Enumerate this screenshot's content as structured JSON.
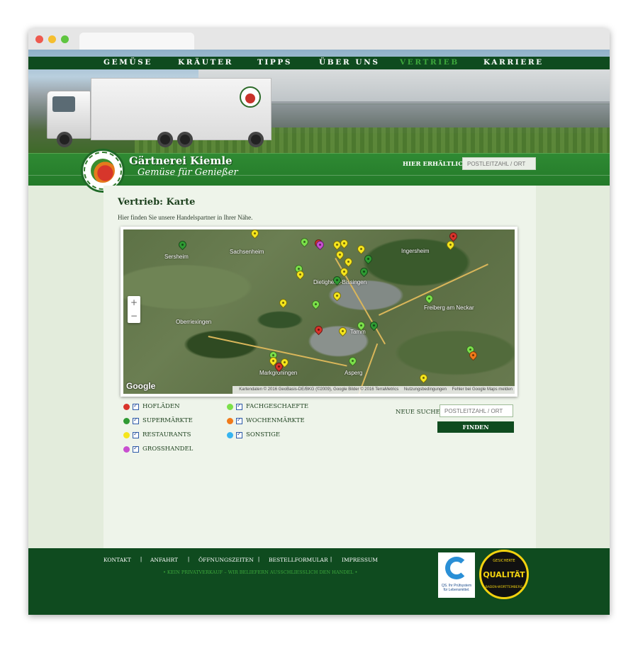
{
  "nav": {
    "items": [
      {
        "label": "GEMÜSE"
      },
      {
        "label": "KRÄUTER"
      },
      {
        "label": "TIPPS"
      },
      {
        "label": "ÜBER UNS"
      },
      {
        "label": "VERTRIEB",
        "active": true
      },
      {
        "label": "KARRIERE"
      }
    ]
  },
  "brand": {
    "name": "Gärtnerei Kiemle",
    "slogan": "Gemüse für Genießer"
  },
  "header_search": {
    "label": "HIER ERHÄLTLICH:",
    "placeholder": "POSTLEITZAHL / ORT"
  },
  "page": {
    "title_prefix": "Vertrieb: ",
    "title_bold": "Karte",
    "intro": "Hier finden Sie unsere Handelspartner in Ihrer Nähe."
  },
  "map": {
    "places": [
      "Sersheim",
      "Sachsenheim",
      "Ingersheim",
      "Dietigheim-Bissingen",
      "Oberriexingen",
      "Freiberg am Neckar",
      "Markgröningen",
      "Asperg",
      "Tamm"
    ],
    "zoom_in": "+",
    "zoom_out": "−",
    "google_label": "Google",
    "attribution": "Kartendaten © 2016 GeoBasis-DE/BKG (©2009), Google Bilder © 2016 TerraMetrics",
    "terms": "Nutzungsbedingungen",
    "report": "Fehler bei Google Maps melden"
  },
  "legend": {
    "items": [
      {
        "label": "HOFLÄDEN",
        "color": "#d9342b"
      },
      {
        "label": "SUPERMÄRKTE",
        "color": "#2f9a33"
      },
      {
        "label": "RESTAURANTS",
        "color": "#f5e51d"
      },
      {
        "label": "GROSSHANDEL",
        "color": "#c84fd0"
      },
      {
        "label": "FACHGESCHAEFTE",
        "color": "#7be04a"
      },
      {
        "label": "WOCHENMÄRKTE",
        "color": "#f07a1a"
      },
      {
        "label": "SONSTIGE",
        "color": "#36b4f0"
      }
    ]
  },
  "new_search": {
    "label": "NEUE SUCHE:",
    "placeholder": "POSTLEITZAHL / ORT",
    "button": "FINDEN"
  },
  "footer": {
    "links": [
      "KONTAKT",
      "ANFAHRT",
      "ÖFFNUNGSZEITEN",
      "BESTELLFORMULAR",
      "IMPRESSUM"
    ],
    "separator": "|",
    "note": "• KEIN PRIVATVERKAUF – WIR BELIEFERN AUSSCHLIESSLICH DEN HANDEL •",
    "qs_badge_text": "QS. Ihr Prüfsystem für Lebensmittel.",
    "quality_seal_top": "GESICHERTE",
    "quality_seal_text": "QUALITÄT",
    "quality_seal_bottom": "BADEN-WÜRTTEMBERG"
  },
  "colors": {
    "brand_dark_green": "#0f4b1f",
    "accent_green": "#3da73c",
    "content_bg": "#eef4ea"
  }
}
